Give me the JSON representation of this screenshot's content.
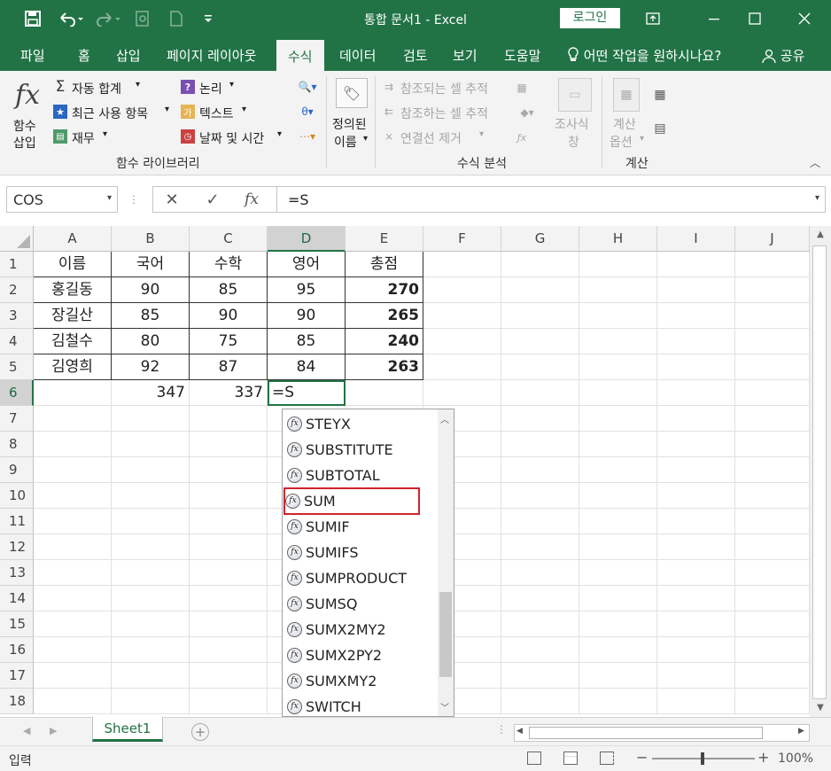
{
  "window": {
    "title": "통합 문서1  -  Excel",
    "login_label": "로그인"
  },
  "colors": {
    "accent": "#217346",
    "highlight": "#d2232a"
  },
  "tabs": [
    "파일",
    "홈",
    "삽입",
    "페이지 레이아웃",
    "수식",
    "데이터",
    "검토",
    "보기",
    "도움말"
  ],
  "active_tab": "수식",
  "tell_me": "어떤 작업을 원하시나요?",
  "share": "공유",
  "ribbon": {
    "insert_fn": [
      "함수",
      "삽입"
    ],
    "autosum": "자동 합계",
    "recent": "최근 사용 항목",
    "finance": "재무",
    "logical": "논리",
    "text": "텍스트",
    "datetime": "날짜 및 시간",
    "names": [
      "정의된",
      "이름"
    ],
    "lib_group": "함수 라이브러리",
    "trace_prec": "참조되는 셀 추적",
    "trace_dep": "참조하는 셀 추적",
    "remove_arrows": "연결선 제거",
    "watch": [
      "조사식",
      "창"
    ],
    "audit_group": "수식 분석",
    "calc_options": [
      "계산",
      "옵션"
    ],
    "calc_group": "계산"
  },
  "formula_bar": {
    "name_box": "COS",
    "content": "=S"
  },
  "columns": [
    "A",
    "B",
    "C",
    "D",
    "E",
    "F",
    "G",
    "H",
    "I",
    "J"
  ],
  "rows": [
    "1",
    "2",
    "3",
    "4",
    "5",
    "6",
    "7",
    "8",
    "9",
    "10",
    "11",
    "12",
    "13",
    "14",
    "15",
    "16",
    "17",
    "18"
  ],
  "table": {
    "header": [
      "이름",
      "국어",
      "수학",
      "영어",
      "총점"
    ],
    "body": [
      [
        "홍길동",
        "90",
        "85",
        "95",
        "270"
      ],
      [
        "장길산",
        "85",
        "90",
        "90",
        "265"
      ],
      [
        "김철수",
        "80",
        "75",
        "85",
        "240"
      ],
      [
        "김영희",
        "92",
        "87",
        "84",
        "263"
      ]
    ],
    "row6": [
      "",
      "347",
      "337",
      "=S",
      ""
    ]
  },
  "autocomplete": [
    "STEYX",
    "SUBSTITUTE",
    "SUBTOTAL",
    "SUM",
    "SUMIF",
    "SUMIFS",
    "SUMPRODUCT",
    "SUMSQ",
    "SUMX2MY2",
    "SUMX2PY2",
    "SUMXMY2",
    "SWITCH"
  ],
  "autocomplete_selected": "SUM",
  "sheet_tab": "Sheet1",
  "status": {
    "mode": "입력",
    "zoom": "100%"
  }
}
